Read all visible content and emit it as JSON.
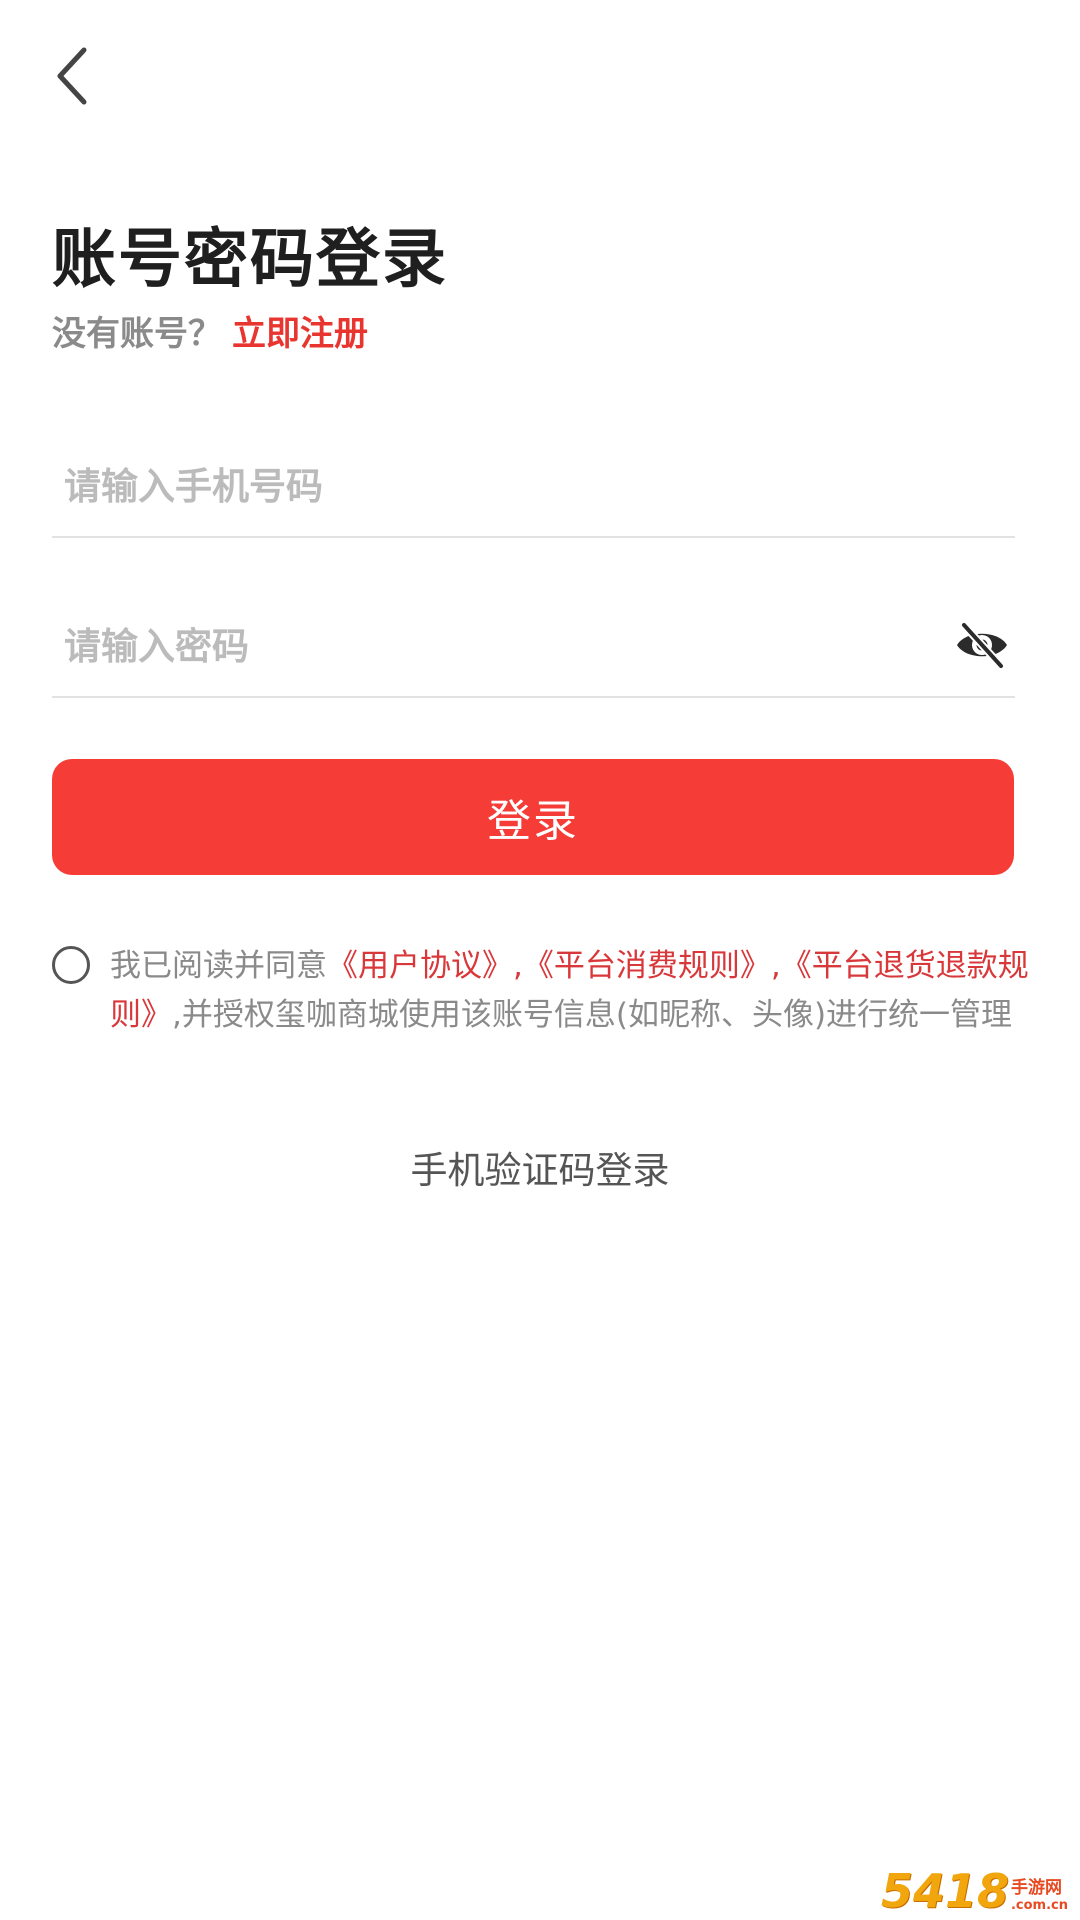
{
  "nav": {
    "back_icon": "chevron-left-icon"
  },
  "header": {
    "title": "账号密码登录",
    "register_prompt": "没有账号？",
    "register_link": "立即注册"
  },
  "form": {
    "phone_placeholder": "请输入手机号码",
    "phone_value": "",
    "password_placeholder": "请输入密码",
    "password_value": "",
    "password_toggle_icon": "eye-slash-icon",
    "login_button": "登录"
  },
  "agreement": {
    "checked": false,
    "prefix": "我已阅读并同意",
    "link_user_agreement": "《用户协议》",
    "sep1": ",",
    "link_consumption_rules": "《平台消费规则》",
    "sep2": ",",
    "link_refund_rules": "《平台退货退款规则》",
    "suffix": ",并授权玺咖商城使用该账号信息(如昵称、头像)进行统一管理"
  },
  "alt_login": {
    "sms_login": "手机验证码登录"
  },
  "watermark": {
    "logo": "5418",
    "cn": "手游网",
    "domain": ".com.cn"
  },
  "colors": {
    "accent": "#f53c37",
    "link": "#d9383a",
    "placeholder": "#bbbbbb"
  }
}
